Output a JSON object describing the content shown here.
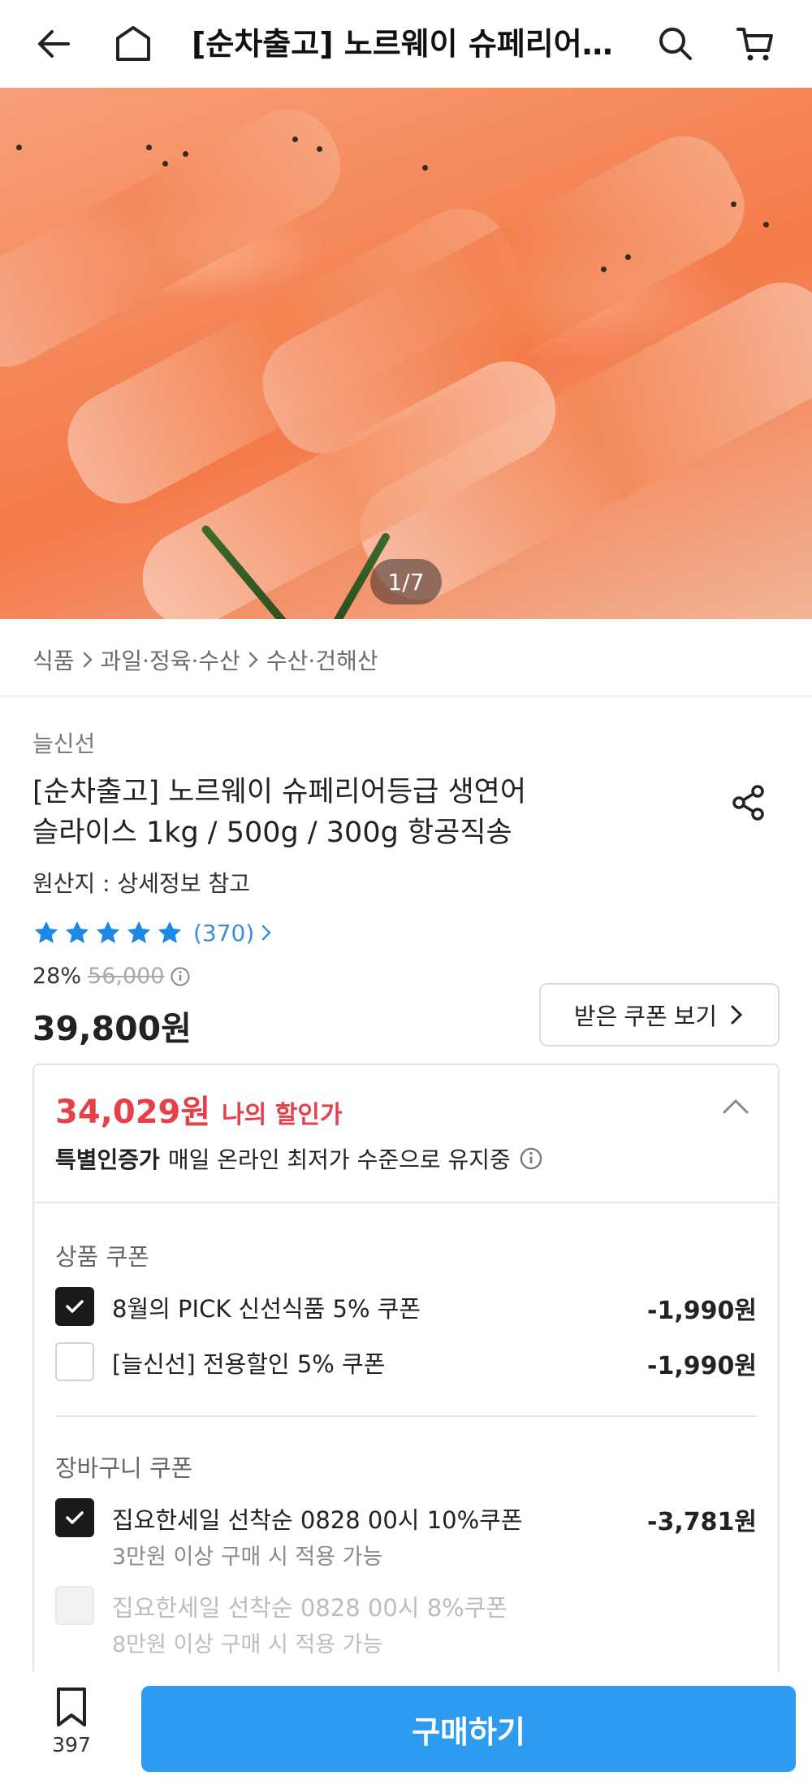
{
  "header": {
    "title": "[순차출고] 노르웨이 슈페리어…",
    "back_icon": "back-arrow-icon",
    "home_icon": "home-icon",
    "search_icon": "search-icon",
    "cart_icon": "cart-icon"
  },
  "gallery": {
    "counter": "1/7"
  },
  "breadcrumb": {
    "items": [
      "식품",
      "과일·정육·수산",
      "수산·건해산"
    ]
  },
  "product": {
    "brand": "늘신선",
    "title_line1": "[순차출고] 노르웨이 슈페리어등급 생연어",
    "title_line2": "슬라이스 1kg / 500g / 300g 항공직송",
    "origin": "원산지 : 상세정보 참고",
    "rating": {
      "stars": 5,
      "count": "(370)"
    },
    "discount_rate": "28%",
    "original_price": "56,000",
    "price": "39,800원",
    "coupon_button": "받은 쿠폰 보기"
  },
  "discount": {
    "my_price": "34,029원",
    "my_price_label": "나의 할인가",
    "cert_bold": "특별인증가",
    "cert_text": "매일 온라인 최저가 수준으로 유지중",
    "product_coupons_label": "상품 쿠폰",
    "product_coupons": [
      {
        "name": "8월의 PICK 신선식품 5% 쿠폰",
        "amount": "-1,990원",
        "checked": true
      },
      {
        "name": "[늘신선] 전용할인 5% 쿠폰",
        "amount": "-1,990원",
        "checked": false
      }
    ],
    "cart_coupons_label": "장바구니 쿠폰",
    "cart_coupons": [
      {
        "name": "집요한세일 선착순 0828 00시 10%쿠폰",
        "sub": "3만원 이상 구매 시 적용 가능",
        "amount": "-3,781원",
        "checked": true
      },
      {
        "name": "집요한세일 선착순 0828 00시 8%쿠폰",
        "sub": "8만원 이상 구매 시 적용 가능",
        "amount": "",
        "checked": false,
        "disabled": true
      }
    ]
  },
  "bottom": {
    "wish_count": "397",
    "buy_label": "구매하기"
  },
  "colors": {
    "accent_blue": "#2d9cf0",
    "sale_red": "#e8404a",
    "star_blue": "#1e88e5"
  }
}
